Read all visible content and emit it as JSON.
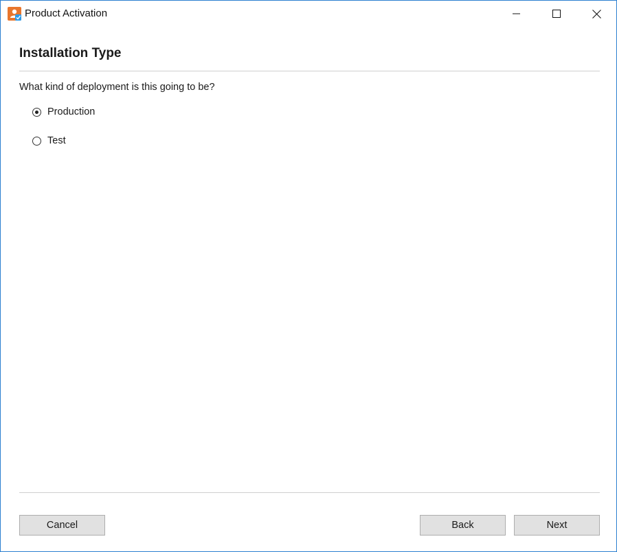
{
  "window": {
    "title": "Product Activation",
    "icon": "product-activation-app-icon",
    "controls": {
      "minimize": "minimize-icon",
      "maximize": "maximize-icon",
      "close": "close-icon"
    },
    "accent": "#2b7fd0"
  },
  "page": {
    "heading": "Installation Type",
    "question": "What kind of deployment is this going to be?",
    "options": [
      {
        "label": "Production",
        "selected": true
      },
      {
        "label": "Test",
        "selected": false
      }
    ]
  },
  "buttons": {
    "cancel": "Cancel",
    "back": "Back",
    "next": "Next"
  }
}
